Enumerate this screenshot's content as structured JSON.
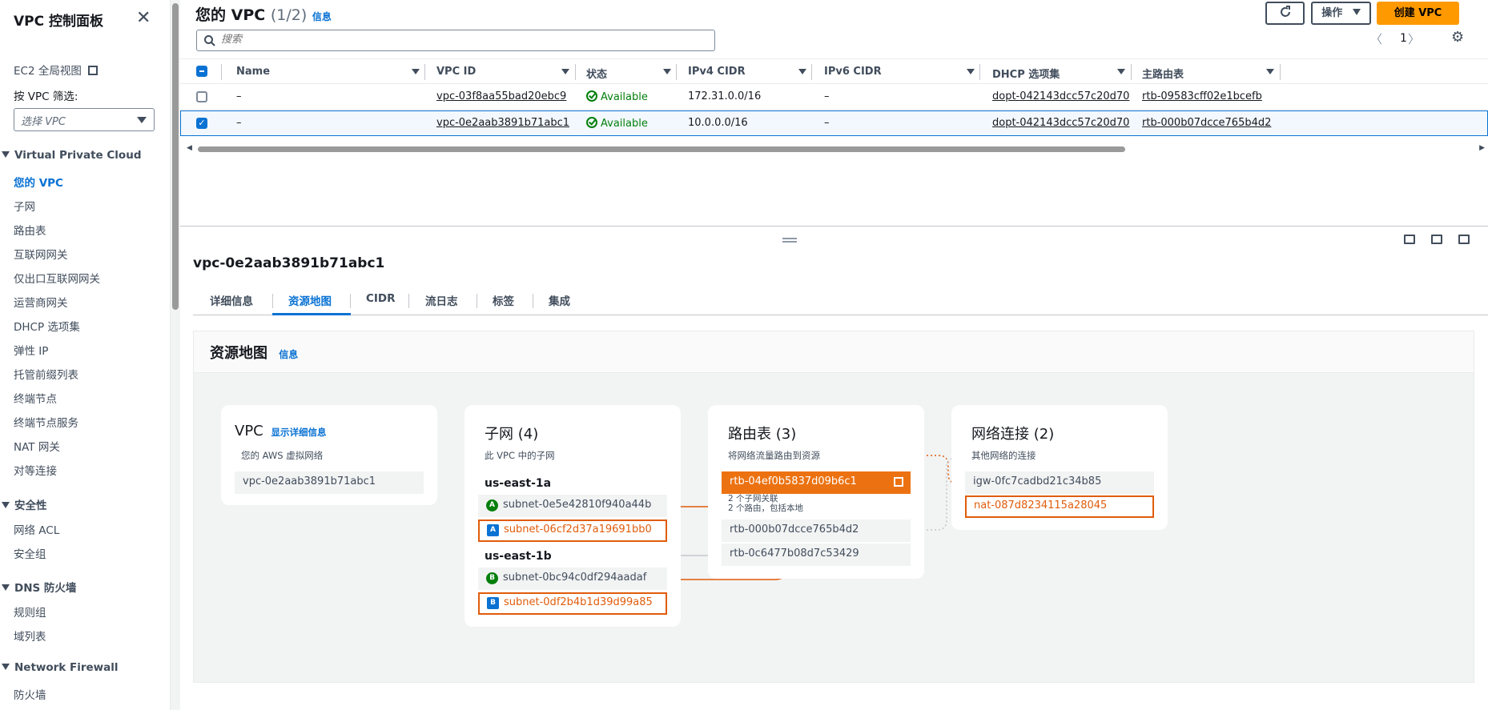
{
  "sidebar": {
    "title": "VPC 控制面板",
    "ec2_global": "EC2 全局视图",
    "filter_label": "按 VPC 筛选:",
    "filter_placeholder": "选择 VPC",
    "sections": [
      {
        "title": "Virtual Private Cloud",
        "items": [
          "您的 VPC",
          "子网",
          "路由表",
          "互联网网关",
          "仅出口互联网网关",
          "运营商网关",
          "DHCP 选项集",
          "弹性 IP",
          "托管前缀列表",
          "终端节点",
          "终端节点服务",
          "NAT 网关",
          "对等连接"
        ]
      },
      {
        "title": "安全性",
        "items": [
          "网络 ACL",
          "安全组"
        ]
      },
      {
        "title": "DNS 防火墙",
        "items": [
          "规则组",
          "域列表"
        ]
      },
      {
        "title": "Network Firewall",
        "items": [
          "防火墙"
        ]
      }
    ]
  },
  "header": {
    "title": "您的 VPC",
    "count": "(1/2)",
    "info": "信息",
    "actions_label": "操作",
    "create_label": "创建 VPC",
    "search_placeholder": "搜索",
    "page": "1"
  },
  "table": {
    "columns": [
      "Name",
      "VPC ID",
      "状态",
      "IPv4 CIDR",
      "IPv6 CIDR",
      "DHCP 选项集",
      "主路由表"
    ],
    "rows": [
      {
        "name": "–",
        "vpc_id": "vpc-03f8aa55bad20ebc9",
        "status": "Available",
        "ipv4": "172.31.0.0/16",
        "ipv6": "–",
        "dhcp": "dopt-042143dcc57c20d70",
        "rtb": "rtb-09583cff02e1bcefb",
        "selected": false
      },
      {
        "name": "–",
        "vpc_id": "vpc-0e2aab3891b71abc1",
        "status": "Available",
        "ipv4": "10.0.0.0/16",
        "ipv6": "–",
        "dhcp": "dopt-042143dcc57c20d70",
        "rtb": "rtb-000b07dcce765b4d2",
        "selected": true
      }
    ]
  },
  "detail": {
    "vpc_id": "vpc-0e2aab3891b71abc1",
    "tabs": [
      "详细信息",
      "资源地图",
      "CIDR",
      "流日志",
      "标签",
      "集成"
    ],
    "active_tab": "资源地图",
    "map": {
      "title": "资源地图",
      "info": "信息",
      "vpc_card": {
        "title": "VPC",
        "link": "显示详细信息",
        "subtitle": "您的 AWS 虚拟网络",
        "vpc": "vpc-0e2aab3891b71abc1"
      },
      "subnet_card": {
        "title": "子网 (4)",
        "subtitle": "此 VPC 中的子网",
        "zones": [
          {
            "name": "us-east-1a",
            "subnets": [
              {
                "badge": "A",
                "type": "public",
                "id": "subnet-0e5e42810f940a44b"
              },
              {
                "badge": "A",
                "type": "private",
                "id": "subnet-06cf2d37a19691bb0"
              }
            ]
          },
          {
            "name": "us-east-1b",
            "subnets": [
              {
                "badge": "B",
                "type": "public",
                "id": "subnet-0bc94c0df294aadaf"
              },
              {
                "badge": "B",
                "type": "private",
                "id": "subnet-0df2b4b1d39d99a85"
              }
            ]
          }
        ]
      },
      "route_card": {
        "title": "路由表 (3)",
        "subtitle": "将网络流量路由到资源",
        "tables": [
          "rtb-04ef0b5837d09b6c1",
          "rtb-000b07dcce765b4d2",
          "rtb-0c6477b08d7c53429"
        ],
        "selected_note_1": "2 个子网关联",
        "selected_note_2": "2 个路由，包括本地"
      },
      "network_card": {
        "title": "网络连接 (2)",
        "subtitle": "其他网络的连接",
        "items": [
          "igw-0fc7cadbd21c34b85",
          "nat-087d8234115a28045"
        ]
      }
    }
  },
  "colors": {
    "accent": "#0972d3",
    "primary_button": "#ff9900",
    "highlight": "#ec7211",
    "success": "#037f0c"
  }
}
